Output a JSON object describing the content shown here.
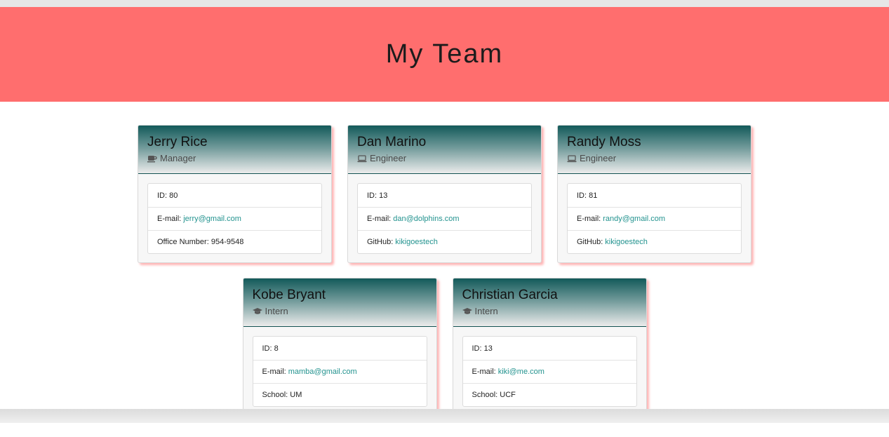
{
  "header": {
    "title": "My Team"
  },
  "labels": {
    "id": "ID:",
    "email": "E-mail:"
  },
  "colors": {
    "header_bg": "#ff6e6e",
    "card_header_dark": "#135a5a",
    "link": "#23938f"
  },
  "employees": [
    {
      "name": "Jerry Rice",
      "role": "Manager",
      "role_icon": "coffee-icon",
      "id": "80",
      "email": "jerry@gmail.com",
      "extra_label": "Office Number:",
      "extra_value": "954-9548"
    },
    {
      "name": "Dan Marino",
      "role": "Engineer",
      "role_icon": "laptop-icon",
      "id": "13",
      "email": "dan@dolphins.com",
      "extra_label": "GitHub:",
      "extra_value": "kikigoestech"
    },
    {
      "name": "Randy Moss",
      "role": "Engineer",
      "role_icon": "laptop-icon",
      "id": "81",
      "email": "randy@gmail.com",
      "extra_label": "GitHub:",
      "extra_value": "kikigoestech"
    },
    {
      "name": "Kobe Bryant",
      "role": "Intern",
      "role_icon": "graduation-cap-icon",
      "id": "8",
      "email": "mamba@gmail.com",
      "extra_label": "School:",
      "extra_value": "UM"
    },
    {
      "name": "Christian Garcia",
      "role": "Intern",
      "role_icon": "graduation-cap-icon",
      "id": "13",
      "email": "kiki@me.com",
      "extra_label": "School:",
      "extra_value": "UCF"
    }
  ]
}
